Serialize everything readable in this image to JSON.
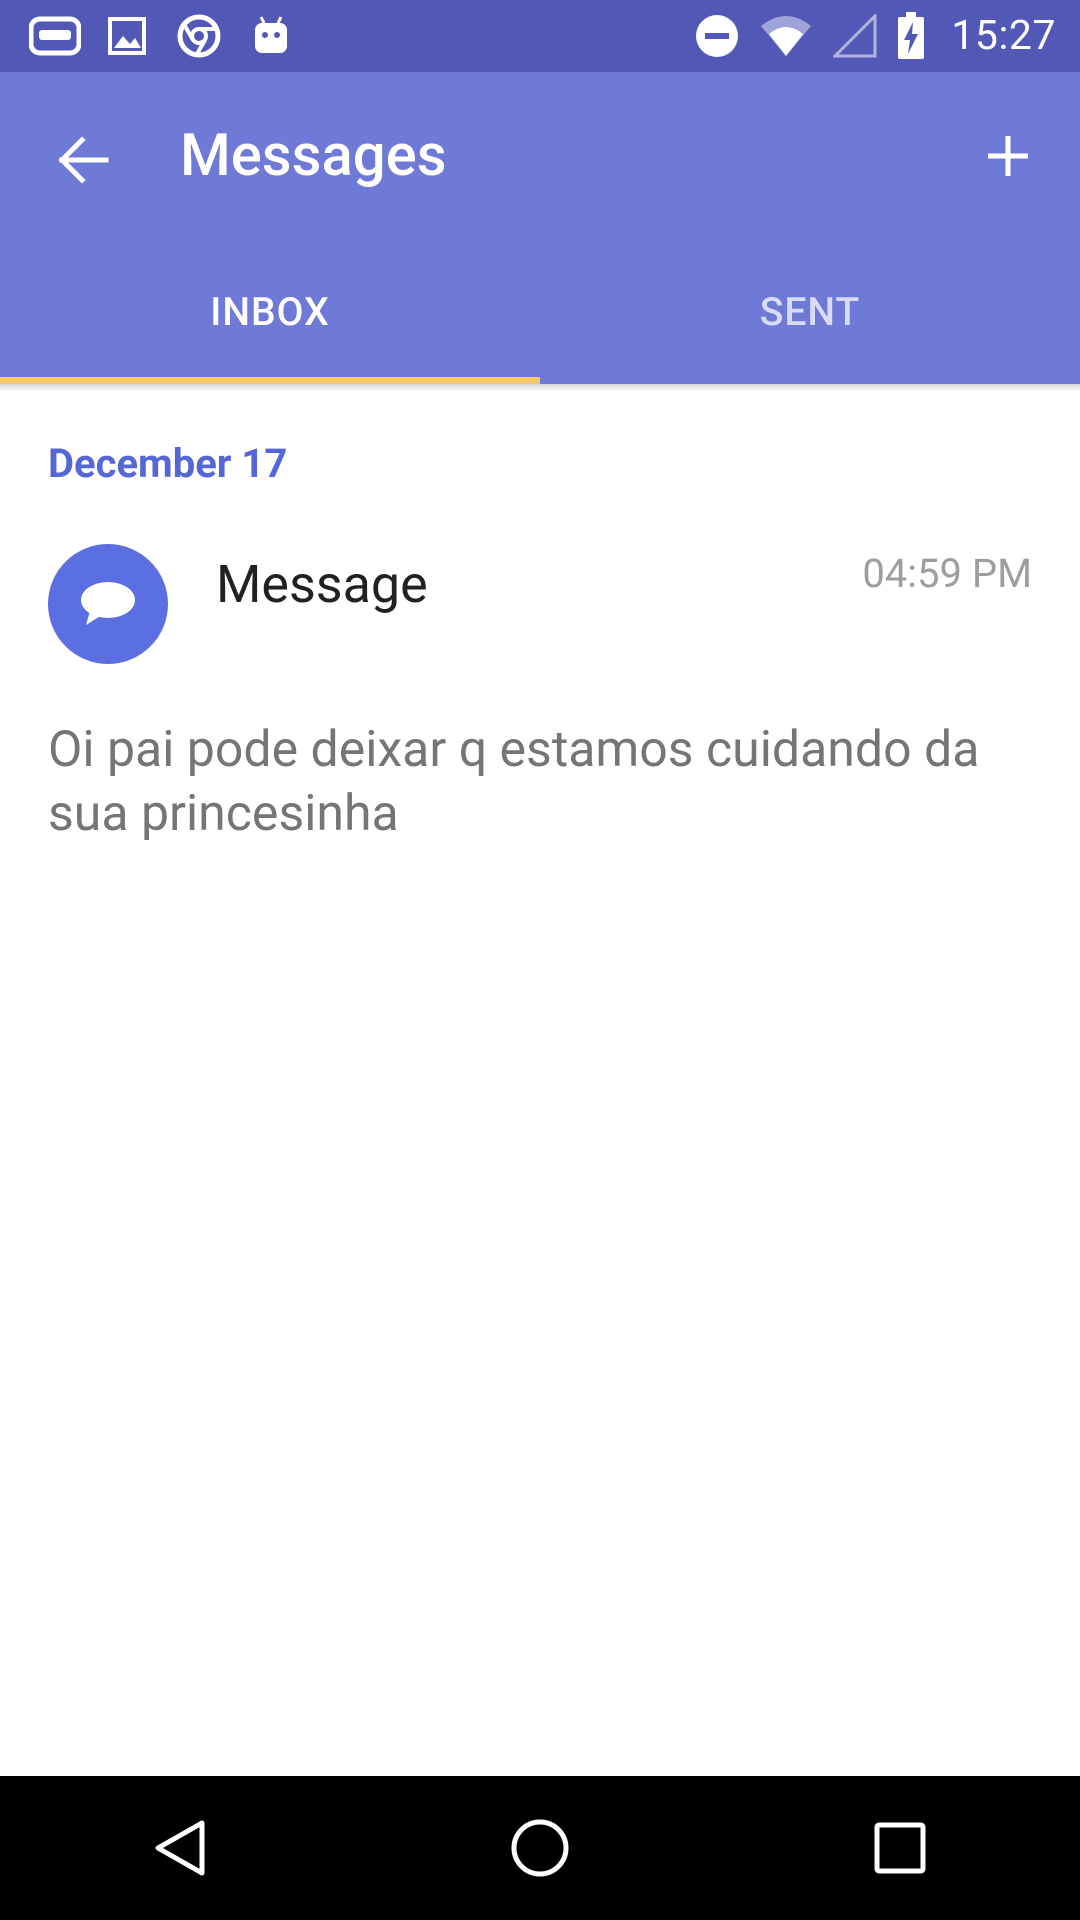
{
  "status_bar": {
    "time": "15:27",
    "left_icons": [
      "game-controller-icon",
      "image-icon",
      "chrome-icon",
      "android-icon"
    ],
    "right_icons": [
      "do-not-disturb-icon",
      "wifi-icon",
      "cell-signal-icon",
      "battery-charging-icon"
    ]
  },
  "toolbar": {
    "title": "Messages",
    "back_icon": "arrow-back-icon",
    "add_icon": "add-icon"
  },
  "tabs": [
    {
      "label": "INBOX",
      "active": true
    },
    {
      "label": "SENT",
      "active": false
    }
  ],
  "inbox": {
    "date_header": "December 17",
    "messages": [
      {
        "sender": "Message",
        "time": "04:59 PM",
        "snippet": "Oi pai pode deixar q estamos cuidando da sua princesinha",
        "icon": "chat-bubble-icon"
      }
    ]
  },
  "colors": {
    "status_bar": "#5258b6",
    "app_bar": "#6f7ad6",
    "tab_indicator": "#f7c96a",
    "date_header": "#5566d6",
    "avatar": "#5b6fe2"
  },
  "nav_bar": {
    "buttons": [
      "back-triangle-icon",
      "home-circle-icon",
      "recents-square-icon"
    ]
  }
}
